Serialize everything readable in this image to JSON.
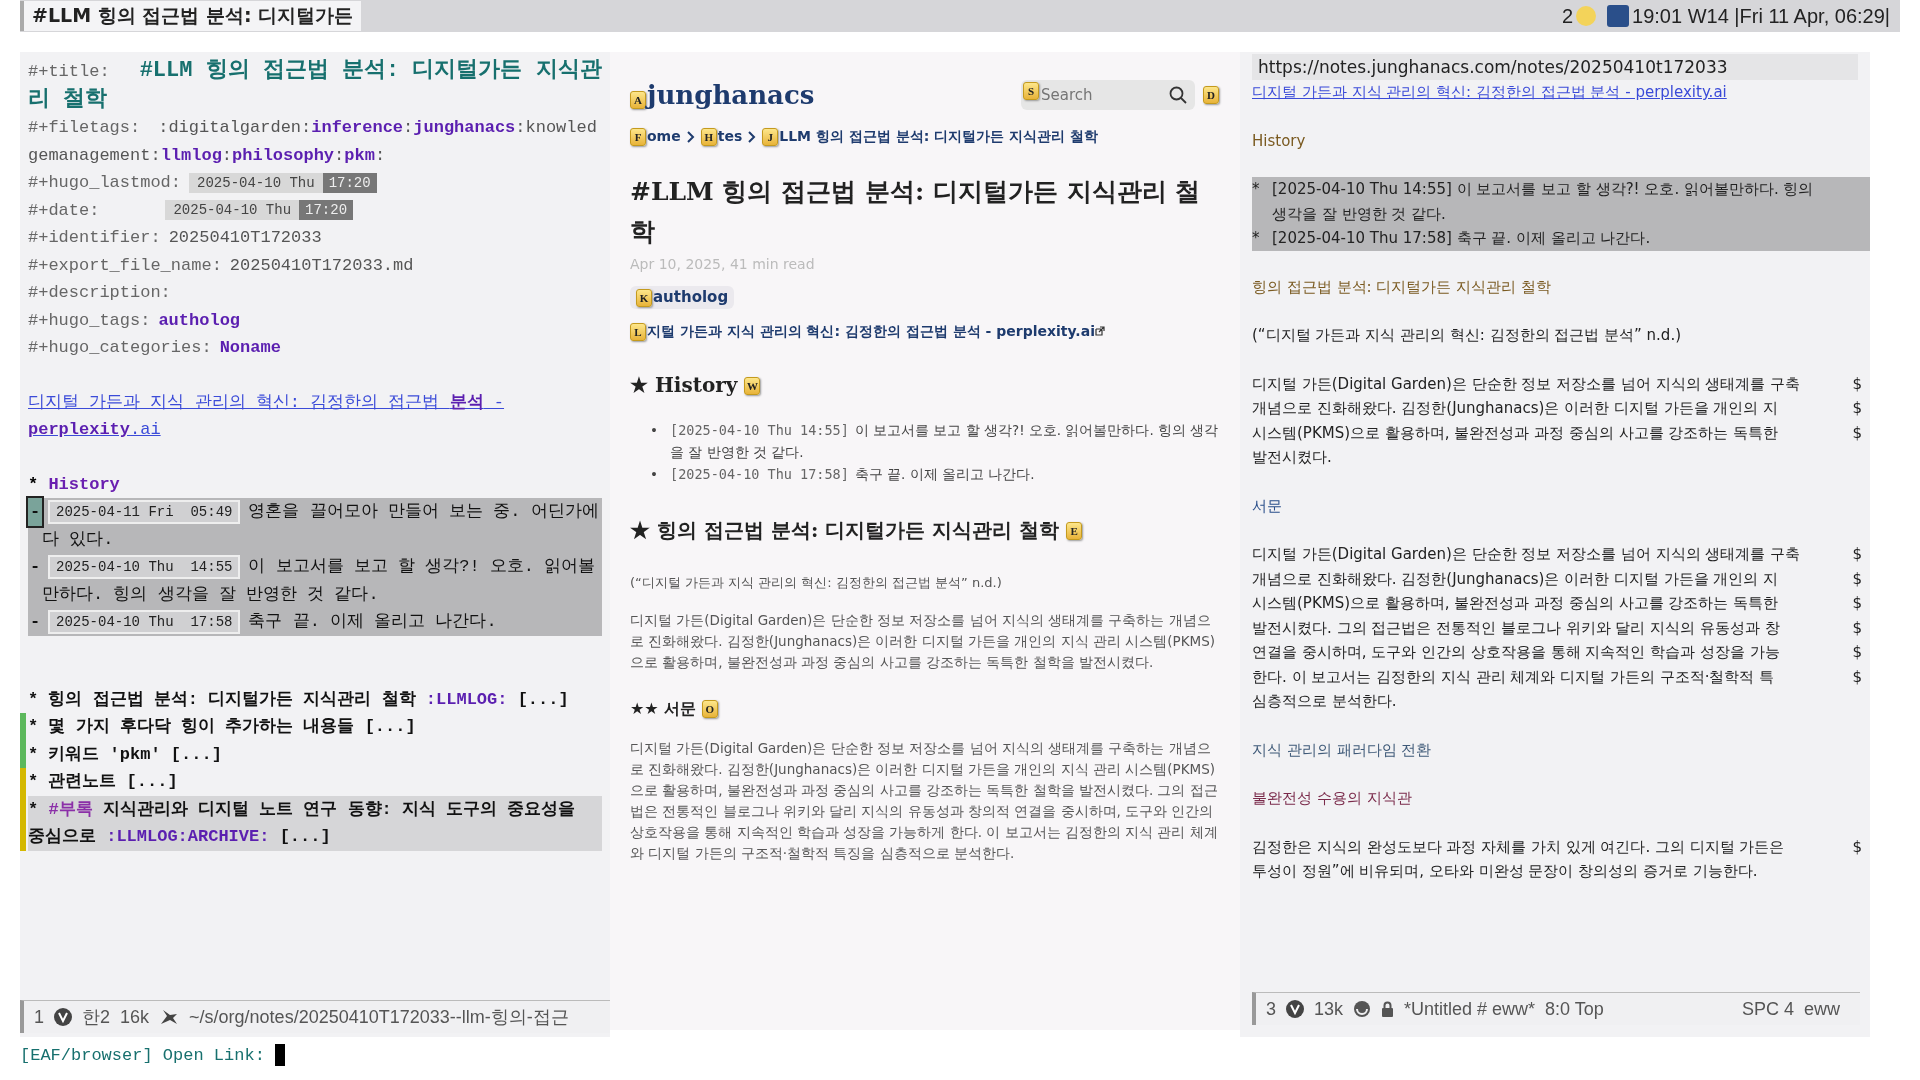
{
  "top_bar": {
    "title": "#LLM 힝의 접근법 분석: 디지털가든",
    "workspace": "2",
    "clock": "19:01 W14 |Fri 11 Apr, 06:29|"
  },
  "editor": {
    "keywords": [
      {
        "kind": "title",
        "key": "#+title:",
        "value": "#LLM 힝의 접근법 분석: 디지털가든 지식관리 철학"
      },
      {
        "kind": "tags",
        "key": "#+filetags:",
        "value": ":digitalgarden:**inference**:**junghanacs**:knowledgemanagement:**llmlog**:**philosophy**:**pkm**:"
      },
      {
        "kind": "timestamp",
        "key": "#+hugo_lastmod:",
        "date": "2025-04-10 Thu",
        "time": "17:20"
      },
      {
        "kind": "timestamp",
        "key": "#+date:",
        "date": "2025-04-10 Thu",
        "time": "17:20"
      },
      {
        "kind": "plain",
        "key": "#+identifier:",
        "value": "20250410T172033"
      },
      {
        "kind": "plain",
        "key": "#+export_file_name:",
        "value": "20250410T172033.md"
      },
      {
        "kind": "plain",
        "key": "#+description:"
      },
      {
        "kind": "keyword",
        "key": "#+hugo_tags:",
        "value": "autholog"
      },
      {
        "kind": "keyword",
        "key": "#+hugo_categories:",
        "value": "Noname"
      }
    ],
    "link": "디지털 가든과 지식 관리의 혁신: 김정한의 접근법 **분석** - **perplexity**.ai",
    "history": {
      "star": "*",
      "title": "History",
      "items": [
        {
          "bullet": "-",
          "date": "2025-04-11 Fri  05:49",
          "text": "영혼을 끌어모아 만들어 보는 중. 어딘가에 다 있다.",
          "cursor": true
        },
        {
          "bullet": "-",
          "date": "2025-04-10 Thu  14:55",
          "text": "이 보고서를 보고 할 생각?! 오호. 읽어볼만하다. 힝의 생각을 잘 반영한 것 같다.",
          "cursor": false
        },
        {
          "bullet": "-",
          "date": "2025-04-10 Thu  17:58",
          "text": "축구 끝. 이제 올리고 나간다.",
          "cursor": false
        }
      ]
    },
    "headings": [
      {
        "star": "*",
        "text": "힝의 접근법 분석: 디지털가든 지식관리 철학",
        "tags": ":LLMLOG:",
        "fold": "[...]",
        "highlighted": false
      },
      {
        "star": "*",
        "text": "몇 가지 후다닥 힝이 추가하는 내용들",
        "fold": "[...]",
        "color": "#5cb85c",
        "highlighted": false
      },
      {
        "star": "*",
        "text": "키워드 'pkm'",
        "fold": "[...]",
        "color": "#5cb85c",
        "highlighted": false
      },
      {
        "star": "*",
        "text": "관련노트",
        "fold": "[...]",
        "color": "#d4b800",
        "highlighted": false
      },
      {
        "star": "*",
        "prefix": "#부록",
        "text": "지식관리와 디지털 노트 연구 동향: 지식 도구의 중요성을 중심으로",
        "tags": ":LLMLOG:ARCHIVE:",
        "fold": "[...]",
        "color": "#d4b800",
        "highlighted": true
      }
    ],
    "mode_line": {
      "window": "1",
      "input": "한2",
      "size": "16k",
      "path": "~/s/org/notes/20250410T172033--llm-힝의-접근"
    }
  },
  "minibuffer": {
    "prompt": "[EAF/browser] Open Link:"
  },
  "browser_page": {
    "logo": {
      "hint": "A",
      "text": "junghanacs"
    },
    "search": {
      "hint": "S",
      "placeholder": "Search"
    },
    "menu_hint": "D",
    "breadcrumbs": [
      {
        "hint": "F",
        "text": "ome"
      },
      {
        "hint": "H",
        "text": "tes"
      },
      {
        "hint": "J",
        "text": "LLM 힝의 접근법 분석: 디지털가든 지식관리 철학"
      }
    ],
    "title": "#LLM 힝의 접근법 분석: 디지털가든 지식관리 철학",
    "meta": "Apr 10, 2025,  41 min read",
    "tag": {
      "hint": "K",
      "text": "autholog"
    },
    "source_link": {
      "hint": "L",
      "text": "지털 가든과 지식 관리의 혁신: 김정한의 접근법 분석 - perplexity.ai"
    },
    "sections": [
      {
        "kind": "h2",
        "star": "★",
        "text": "History",
        "hint": "W"
      },
      {
        "kind": "list",
        "items": [
          {
            "bullet": "•",
            "time": "[2025-04-10 Thu 14:55]",
            "text": "이 보고서를 보고 할 생각?! 오호. 읽어볼만하다. 힝의 생각을 잘 반영한 것 같다."
          },
          {
            "bullet": "•",
            "time": "[2025-04-10 Thu 17:58]",
            "text": "축구 끝. 이제 올리고 나간다."
          }
        ]
      },
      {
        "kind": "h2",
        "star": "★",
        "text": "힝의 접근법 분석: 디지털가든 지식관리 철학",
        "hint": "E"
      },
      {
        "kind": "cite",
        "text": "(“디지털 가든과 지식 관리의 혁신: 김정한의 접근법 분석” n.d.)"
      },
      {
        "kind": "p",
        "text": "디지털 가든(Digital Garden)은 단순한 정보 저장소를 넘어 지식의 생태계를 구축하는 개념으로 진화해왔다. 김정한(Junghanacs)은 이러한 디지털 가든을 개인의 지식 관리 시스템(PKMS)으로 활용하며, 불완전성과 과정 중심의 사고를 강조하는 독특한 철학을 발전시켰다."
      },
      {
        "kind": "h3",
        "star": "★★",
        "text": "서문",
        "hint": "O"
      },
      {
        "kind": "p",
        "text": "디지털 가든(Digital Garden)은 단순한 정보 저장소를 넘어 지식의 생태계를 구축하는 개념으로 진화해왔다. 김정한(Junghanacs)은 이러한 디지털 가든을 개인의 지식 관리 시스템(PKMS)으로 활용하며, 불완전성과 과정 중심의 사고를 강조하는 독특한 철학을 발전시켰다. 그의 접근법은 전통적인 블로그나 위키와 달리 지식의 유동성과 창의적 연결을 중시하며, 도구와 인간의 상호작용을 통해 지속적인 학습과 성장을 가능하게 한다. 이 보고서는 김정한의 지식 관리 체계와 디지털 가든의 구조적·철학적 특징을 심층적으로 분석한다."
      }
    ]
  },
  "eww": {
    "url": "https://notes.junghanacs.com/notes/20250410t172033",
    "blocks": [
      {
        "kind": "link",
        "lines": [
          {
            "text": "디지털 가든과 지식 관리의 혁신: 김정한의 접근법 분석 - perplexity.ai"
          }
        ]
      },
      {
        "kind": "h1",
        "lines": [
          {
            "text": "History"
          }
        ]
      },
      {
        "kind": "list",
        "lines": [
          {
            "bullet": "*",
            "text": "[2025-04-10 Thu 14:55] 이 보고서를 보고 할 생각?! 오호. 읽어볼만하다. 힝의"
          },
          {
            "text": "생각을 잘 반영한 것 같다."
          },
          {
            "bullet": "*",
            "text": "[2025-04-10 Thu 17:58] 축구 끝. 이제 올리고 나간다."
          }
        ]
      },
      {
        "kind": "h1",
        "lines": [
          {
            "text": "힝의 접근법 분석: 디지털가든 지식관리 철학"
          }
        ]
      },
      {
        "kind": "p",
        "lines": [
          {
            "text": "(“디지털 가든과 지식 관리의 혁신: 김정한의 접근법 분석” n.d.)"
          }
        ]
      },
      {
        "kind": "p",
        "lines": [
          {
            "text": "디지털 가든(Digital Garden)은 단순한 정보 저장소를 넘어 지식의 생태계를 구축",
            "mark": "$"
          },
          {
            "text": "개념으로 진화해왔다. 김정한(Junghanacs)은 이러한 디지털 가든을 개인의 지",
            "mark": "$"
          },
          {
            "text": "시스템(PKMS)으로 활용하며, 불완전성과 과정 중심의 사고를 강조하는 독특한",
            "mark": "$"
          },
          {
            "text": "발전시켰다."
          }
        ]
      },
      {
        "kind": "h2",
        "lines": [
          {
            "text": "서문"
          }
        ]
      },
      {
        "kind": "p",
        "lines": [
          {
            "text": "디지털 가든(Digital Garden)은 단순한 정보 저장소를 넘어 지식의 생태계를 구축",
            "mark": "$"
          },
          {
            "text": "개념으로 진화해왔다. 김정한(Junghanacs)은 이러한 디지털 가든을 개인의 지",
            "mark": "$"
          },
          {
            "text": "시스템(PKMS)으로 활용하며, 불완전성과 과정 중심의 사고를 강조하는 독특한",
            "mark": "$"
          },
          {
            "text": "발전시켰다. 그의 접근법은 전통적인 블로그나 위키와 달리 지식의 유동성과 창",
            "mark": "$"
          },
          {
            "text": "연결을 중시하며, 도구와 인간의 상호작용을 통해 지속적인 학습과 성장을 가능",
            "mark": "$"
          },
          {
            "text": "한다. 이 보고서는 김정한의 지식 관리 체계와 디지털 가든의 구조적·철학적 특",
            "mark": "$"
          },
          {
            "text": "심층적으로 분석한다."
          }
        ]
      },
      {
        "kind": "h3",
        "lines": [
          {
            "text": "지식 관리의 패러다임 전환"
          }
        ]
      },
      {
        "kind": "h4",
        "lines": [
          {
            "text": "불완전성 수용의 지식관"
          }
        ]
      },
      {
        "kind": "p",
        "lines": [
          {
            "text": "김정한은 지식의 완성도보다 과정 자체를 가치 있게 여긴다. 그의 디지털 가든은",
            "mark": "$"
          },
          {
            "text": "투성이 정원”에 비유되며, 오타와 미완성 문장이 창의성의 증거로 기능한다."
          }
        ]
      }
    ],
    "mode_line": {
      "window": "3",
      "size": "13k",
      "buffer": "*Untitled # eww*",
      "position": "8:0 Top",
      "leader": "SPC 4",
      "mode": "eww"
    }
  }
}
